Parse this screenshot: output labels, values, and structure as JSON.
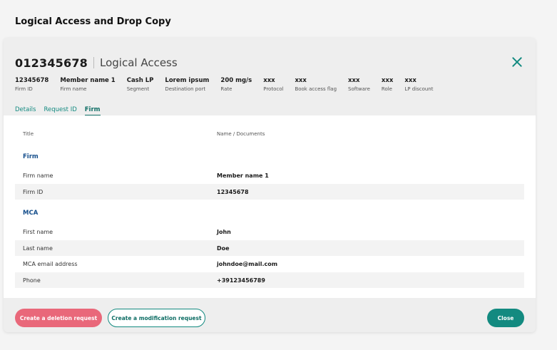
{
  "page": {
    "title": "Logical Access and Drop Copy"
  },
  "modal": {
    "record_id": "012345678",
    "record_name": "Logical Access",
    "meta": [
      {
        "value": "12345678",
        "label": "Firm ID"
      },
      {
        "value": "Member name 1",
        "label": "Firm name"
      },
      {
        "value": "Cash LP",
        "label": "Segment"
      },
      {
        "value": "Lorem ipsum",
        "label": "Destination port"
      },
      {
        "value": "200 mg/s",
        "label": "Rate"
      },
      {
        "value": "xxx",
        "label": "Protocol"
      },
      {
        "value": "xxx",
        "label": "Book access flag"
      },
      {
        "value": "xxx",
        "label": "Software"
      },
      {
        "value": "xxx",
        "label": "Role"
      },
      {
        "value": "xxx",
        "label": "LP discount"
      }
    ],
    "tabs": [
      {
        "label": "Details",
        "active": false
      },
      {
        "label": "Request ID",
        "active": false
      },
      {
        "label": "Firm",
        "active": true
      }
    ],
    "columns": {
      "title": "Title",
      "name_docs": "Name / Documents"
    },
    "sections": [
      {
        "heading": "Firm",
        "rows": [
          {
            "label": "Firm name",
            "value": "Member name 1"
          },
          {
            "label": "Firm ID",
            "value": "12345678"
          }
        ]
      },
      {
        "heading": "MCA",
        "rows": [
          {
            "label": "First name",
            "value": "John"
          },
          {
            "label": "Last name",
            "value": "Doe"
          },
          {
            "label": "MCA email address",
            "value": "johndoe@mail.com"
          },
          {
            "label": "Phone",
            "value": "+39123456789"
          }
        ]
      }
    ],
    "buttons": {
      "delete": "Create a deletion request",
      "modify": "Create a modification request",
      "close": "Close"
    }
  },
  "colors": {
    "accent": "#138a80",
    "danger": "#e9687a",
    "section": "#164f8c"
  }
}
